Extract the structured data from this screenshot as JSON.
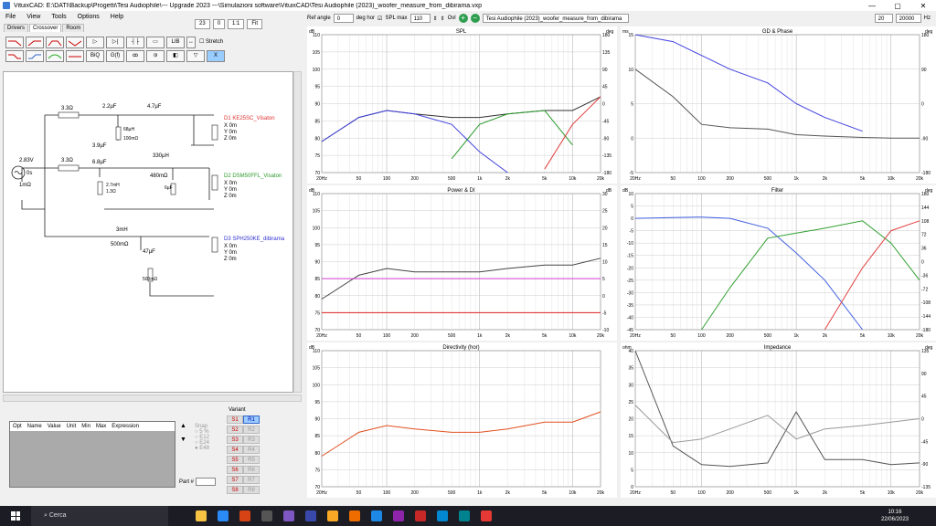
{
  "window": {
    "title": "VituixCAD: E:\\DATI\\Backup\\Progetti\\Tesi Audiophile\\--- Upgrade 2023 ---\\Simulazioni software\\VituixCAD\\Tesi Audiophile (2023)_woofer_measure_from_dibirama.vxp"
  },
  "menu": [
    "File",
    "View",
    "Tools",
    "Options",
    "Help"
  ],
  "zoom": {
    "v1": "23",
    "v2": "0",
    "v3": "1:1",
    "v4": "Fit"
  },
  "tabs": [
    "Drivers",
    "Crossover",
    "Room"
  ],
  "part_buttons": [
    "LIB",
    "BiQ",
    "G(f)",
    "Stretch"
  ],
  "toolbar": {
    "ref_angle_label": "Ref angle",
    "ref_angle": "0",
    "deg_hor": "deg hor",
    "spl_max_label": "SPL max",
    "spl_max": "110",
    "ovl": "Ovl",
    "overlay_file": "Tesi Audiophile (2023)_woofer_measure_from_dibirama",
    "f_low": "20",
    "f_high": "20000",
    "hz": "Hz"
  },
  "schematic": {
    "source": {
      "v": "2.83V",
      "phase": "0s",
      "r": "1mΩ"
    },
    "drivers": [
      {
        "name": "D1 KE25SC_Visaton",
        "color": "#e03030",
        "lines": [
          "X 0m",
          "Y 0m",
          "Z 0m"
        ]
      },
      {
        "name": "D2 DSM50FFL_Visaton",
        "color": "#2a9a2a",
        "lines": [
          "X 0m",
          "Y 0m",
          "Z 0m"
        ]
      },
      {
        "name": "D3 SPH250KE_dibirama",
        "color": "#3030d0",
        "lines": [
          "X 0m",
          "Y 0m",
          "Z 0m"
        ]
      }
    ],
    "parts": [
      "3.3Ω",
      "2.2µF",
      "4.7µF",
      "68µH",
      "100mΩ",
      "3.9µF",
      "3.3Ω",
      "6.8µF",
      "330µH",
      "480mΩ",
      "2.7mH",
      "1.3Ω",
      "6µF",
      "3mH",
      "500mΩ",
      "47µF",
      "500mΩ"
    ]
  },
  "params_table": {
    "headers": [
      "Opt",
      "Name",
      "Value",
      "Unit",
      "Min",
      "Max",
      "Expression"
    ]
  },
  "snap": {
    "label": "Snap",
    "options": [
      "5 %",
      "E12",
      "E24",
      "E48"
    ]
  },
  "variant": {
    "label": "Variant",
    "items": [
      "R1",
      "S1",
      "S2",
      "S3",
      "S4",
      "S5",
      "S6",
      "S7",
      "S8",
      "R2",
      "R3",
      "R4",
      "R5",
      "R6",
      "R7",
      "R8"
    ]
  },
  "part_no": "Part #",
  "freq_ticks": [
    "20Hz",
    "50",
    "100",
    "200",
    "500",
    "1k",
    "2k",
    "5k",
    "10k",
    "20k"
  ],
  "charts": {
    "spl": {
      "title": "SPL",
      "yunit": "dB",
      "y2unit": "deg",
      "yticks": [
        "110",
        "105",
        "100",
        "95",
        "90",
        "85",
        "80",
        "75",
        "70"
      ],
      "y2ticks": [
        "180",
        "135",
        "90",
        "45",
        "0",
        "-45",
        "-90",
        "-135",
        "-180"
      ]
    },
    "gd": {
      "title": "GD & Phase",
      "yunit": "ms",
      "y2unit": "deg",
      "yticks": [
        "15",
        "10",
        "5",
        "0",
        "-5"
      ],
      "y2ticks": [
        "180",
        "90",
        "0",
        "-90",
        "-180"
      ]
    },
    "power": {
      "title": "Power & DI",
      "yunit": "dB",
      "y2unit": "dB",
      "yticks": [
        "110",
        "105",
        "100",
        "95",
        "90",
        "85",
        "80",
        "75",
        "70"
      ],
      "y2ticks": [
        "30",
        "25",
        "20",
        "15",
        "10",
        "5",
        "0",
        "-5",
        "-10"
      ]
    },
    "filter": {
      "title": "Filter",
      "yunit": "dB",
      "y2unit": "deg",
      "yticks": [
        "10",
        "5",
        "0",
        "-5",
        "-10",
        "-15",
        "-20",
        "-25",
        "-30",
        "-35",
        "-40",
        "-45"
      ],
      "y2ticks": [
        "180",
        "144",
        "108",
        "72",
        "36",
        "0",
        "-36",
        "-72",
        "-108",
        "-144",
        "-180"
      ]
    },
    "directivity": {
      "title": "Directivity (hor)",
      "yunit": "dB",
      "yticks": [
        "110",
        "105",
        "100",
        "95",
        "90",
        "85",
        "80",
        "75",
        "70"
      ]
    },
    "impedance": {
      "title": "Impedance",
      "yunit": "ohm",
      "y2unit": "deg",
      "yticks": [
        "40",
        "35",
        "30",
        "25",
        "20",
        "15",
        "10",
        "5",
        "0"
      ],
      "y2ticks": [
        "135",
        "90",
        "45",
        "0",
        "-45",
        "-90",
        "-135"
      ]
    }
  },
  "chart_data": [
    {
      "type": "line",
      "title": "SPL",
      "xlabel": "",
      "ylabel": "dB",
      "x": [
        20,
        50,
        100,
        200,
        500,
        1000,
        2000,
        5000,
        10000,
        20000
      ],
      "ylim": [
        70,
        110
      ],
      "series": [
        {
          "values": [
            79,
            86,
            88,
            87,
            86,
            86,
            87,
            88,
            88,
            92
          ],
          "color": "#333333"
        },
        {
          "values": [
            79,
            86,
            88,
            87,
            84,
            76,
            70,
            null,
            null,
            null
          ],
          "color": "#4040e0"
        },
        {
          "values": [
            null,
            null,
            null,
            null,
            74,
            84,
            87,
            88,
            78,
            null
          ],
          "color": "#2a9a2a"
        },
        {
          "values": [
            null,
            null,
            null,
            null,
            null,
            null,
            null,
            71,
            84,
            92
          ],
          "color": "#e04040"
        }
      ]
    },
    {
      "type": "line",
      "title": "Power & DI",
      "ylabel": "dB",
      "x": [
        20,
        50,
        100,
        200,
        500,
        1000,
        2000,
        5000,
        10000,
        20000
      ],
      "ylim": [
        70,
        110
      ],
      "series": [
        {
          "values": [
            79,
            86,
            88,
            87,
            87,
            87,
            88,
            89,
            89,
            91
          ],
          "color": "#444444"
        },
        {
          "values": [
            85,
            85,
            85,
            85,
            85,
            85,
            85,
            85,
            85,
            85
          ],
          "color": "#d040d0"
        },
        {
          "values": [
            75,
            75,
            75,
            75,
            75,
            75,
            75,
            75,
            75,
            75
          ],
          "color": "#e02020"
        }
      ]
    },
    {
      "type": "line",
      "title": "Directivity (hor)",
      "ylabel": "dB",
      "x": [
        20,
        50,
        100,
        200,
        500,
        1000,
        2000,
        5000,
        10000,
        20000
      ],
      "ylim": [
        70,
        110
      ],
      "series": [
        {
          "values": [
            79,
            86,
            88,
            87,
            86,
            86,
            87,
            89,
            89,
            92
          ],
          "color": "#e05020"
        }
      ]
    },
    {
      "type": "line",
      "title": "Filter",
      "ylabel": "dB",
      "x": [
        20,
        50,
        100,
        200,
        500,
        1000,
        2000,
        5000,
        10000,
        20000
      ],
      "ylim": [
        -45,
        10
      ],
      "series": [
        {
          "values": [
            0,
            0.3,
            0.5,
            0,
            -4,
            -14,
            -25,
            -45,
            null,
            null
          ],
          "color": "#4060e0"
        },
        {
          "values": [
            null,
            null,
            -45,
            -28,
            -8,
            -6,
            -4,
            -1,
            -10,
            -25
          ],
          "color": "#30a030"
        },
        {
          "values": [
            null,
            null,
            null,
            null,
            null,
            null,
            -45,
            -20,
            -5,
            -1
          ],
          "color": "#e04040"
        }
      ]
    },
    {
      "type": "line",
      "title": "GD & Phase",
      "ylabel": "ms",
      "x": [
        20,
        50,
        100,
        200,
        500,
        1000,
        2000,
        5000,
        10000,
        20000
      ],
      "ylim": [
        -5,
        15
      ],
      "series": [
        {
          "values": [
            10,
            6,
            2,
            1.5,
            1.3,
            0.5,
            0.3,
            0.1,
            0,
            0
          ],
          "color": "#555555"
        },
        {
          "values": [
            15,
            14,
            12,
            10,
            8,
            5,
            3,
            1,
            null,
            null
          ],
          "color": "#4040e0"
        }
      ]
    },
    {
      "type": "line",
      "title": "Impedance",
      "ylabel": "ohm",
      "x": [
        20,
        50,
        100,
        200,
        500,
        1000,
        2000,
        5000,
        10000,
        20000
      ],
      "ylim": [
        0,
        40
      ],
      "series": [
        {
          "values": [
            40,
            12,
            6.5,
            6,
            7,
            22,
            8,
            8,
            6.5,
            7
          ],
          "color": "#555555"
        },
        {
          "values": [
            24,
            13,
            14,
            17,
            21,
            14,
            17,
            18,
            19,
            20
          ],
          "color": "#999999"
        }
      ]
    }
  ],
  "taskbar": {
    "search": "Cerca",
    "time": "10:16",
    "date": "22/06/2023"
  }
}
